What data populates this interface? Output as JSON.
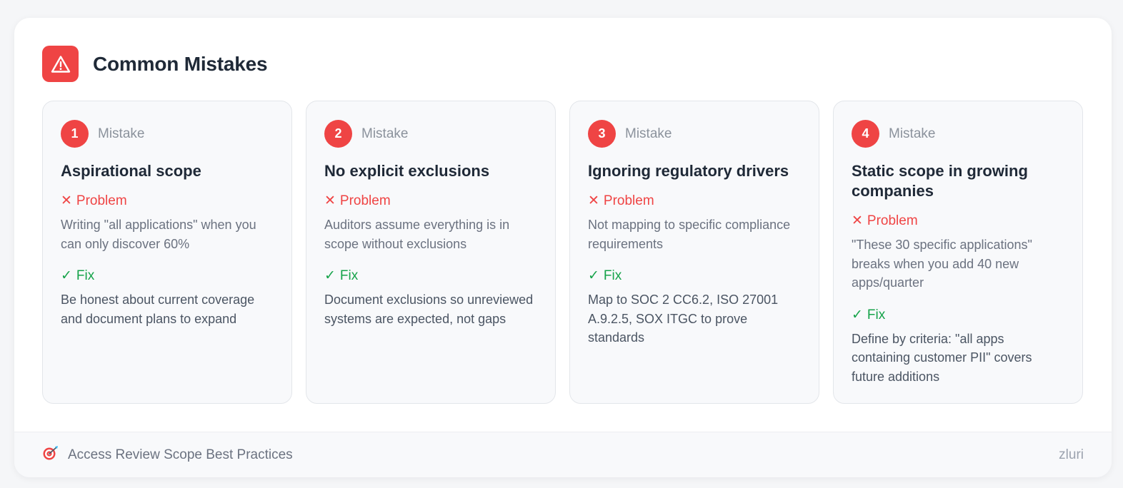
{
  "header": {
    "title": "Common Mistakes",
    "icon": "warning-triangle-icon",
    "accent_color": "#ef4444"
  },
  "cards": [
    {
      "number": "1",
      "tag": "Mistake",
      "title": "Aspirational scope",
      "problem_label": "Problem",
      "problem_text": "Writing \"all applications\" when you can only discover 60%",
      "fix_label": "Fix",
      "fix_text": "Be honest about current coverage and document plans to expand"
    },
    {
      "number": "2",
      "tag": "Mistake",
      "title": "No explicit exclusions",
      "problem_label": "Problem",
      "problem_text": "Auditors assume everything is in scope without exclusions",
      "fix_label": "Fix",
      "fix_text": "Document exclusions so unreviewed systems are expected, not gaps"
    },
    {
      "number": "3",
      "tag": "Mistake",
      "title": "Ignoring regulatory drivers",
      "problem_label": "Problem",
      "problem_text": "Not mapping to specific compliance requirements",
      "fix_label": "Fix",
      "fix_text": "Map to SOC 2 CC6.2, ISO 27001 A.9.2.5, SOX ITGC to prove standards"
    },
    {
      "number": "4",
      "tag": "Mistake",
      "title": "Static scope in growing companies",
      "problem_label": "Problem",
      "problem_text": "\"These 30 specific applications\" breaks when you add 40 new apps/quarter",
      "fix_label": "Fix",
      "fix_text": "Define by criteria: \"all apps containing customer PII\" covers future additions"
    }
  ],
  "footer": {
    "icon": "target-dart-icon",
    "text": "Access Review Scope Best Practices",
    "brand": "zluri"
  },
  "colors": {
    "problem": "#ef4444",
    "fix": "#16a34a",
    "card_bg": "#f8f9fb"
  }
}
